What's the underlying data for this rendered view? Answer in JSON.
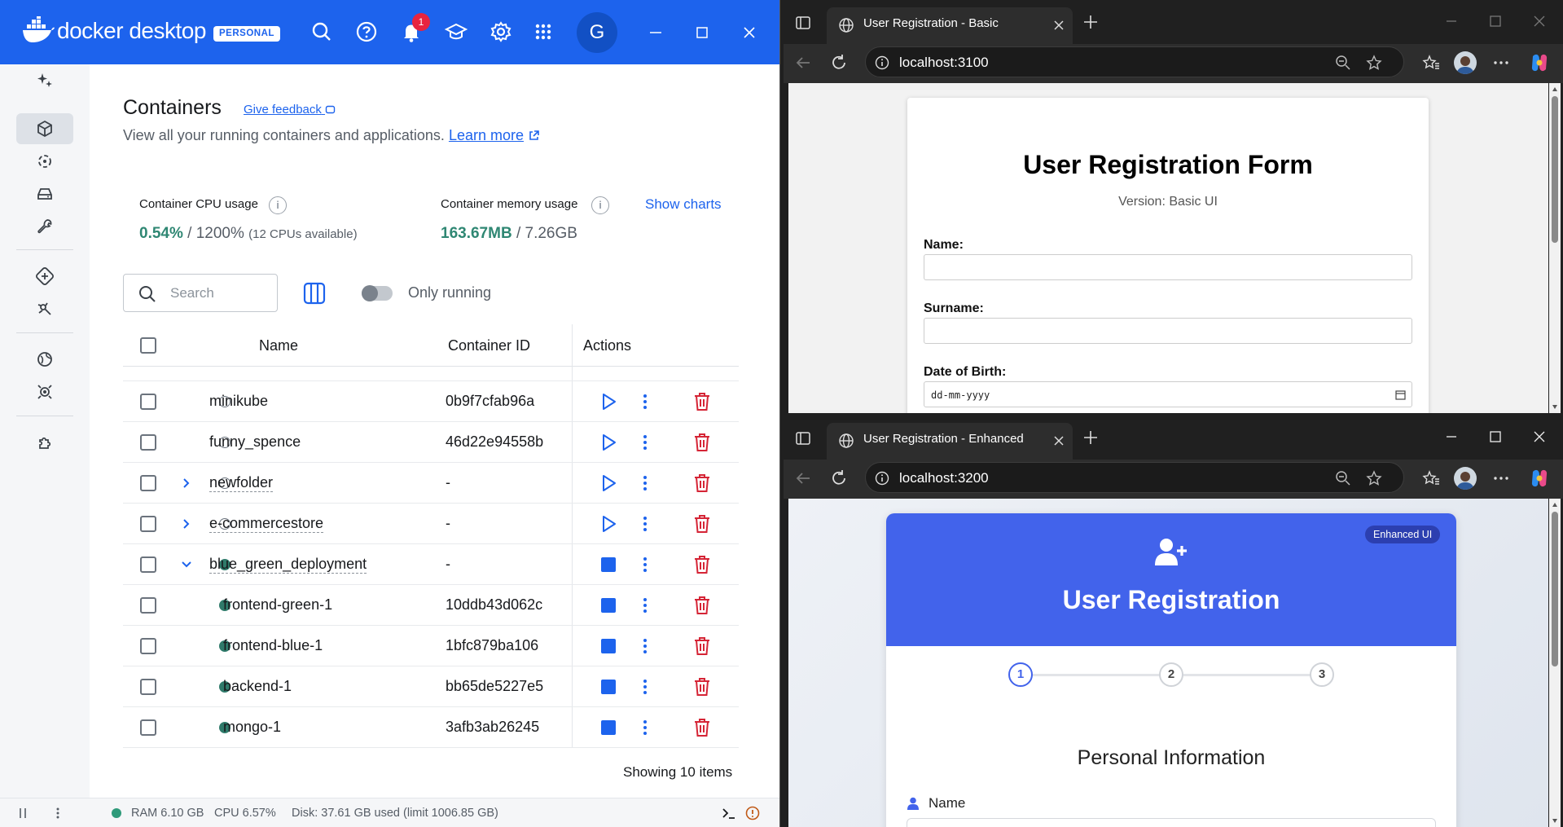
{
  "docker": {
    "brand": "docker desktop",
    "plan_badge": "PERSONAL",
    "notification_count": "1",
    "avatar_initial": "G",
    "title": "Containers",
    "feedback_link": "Give feedback",
    "subtitle": "View all your running containers and applications.",
    "learn_more": "Learn more",
    "cpu_label": "Container CPU usage",
    "cpu_value": "0.54%",
    "cpu_total": "/ 1200%",
    "cpu_note": "(12 CPUs available)",
    "mem_label": "Container memory usage",
    "mem_value": "163.67MB",
    "mem_total": "/ 7.26GB",
    "show_charts": "Show charts",
    "search_placeholder": "Search",
    "only_running": "Only running",
    "columns": {
      "name": "Name",
      "container_id": "Container ID",
      "actions": "Actions"
    },
    "rows": [
      {
        "name": "minikube",
        "id": "0b9f7cfab96a",
        "running": false,
        "group": false,
        "child": false
      },
      {
        "name": "funny_spence",
        "id": "46d22e94558b",
        "running": false,
        "group": false,
        "child": false
      },
      {
        "name": "newfolder",
        "id": "-",
        "running": false,
        "group": true,
        "expanded": false,
        "child": false
      },
      {
        "name": "e-commercestore",
        "id": "-",
        "running": false,
        "group": true,
        "expanded": false,
        "child": false
      },
      {
        "name": "blue_green_deployment",
        "id": "-",
        "running": true,
        "group": true,
        "expanded": true,
        "child": false
      },
      {
        "name": "frontend-green-1",
        "id": "10ddb43d062c",
        "running": true,
        "group": false,
        "child": true
      },
      {
        "name": "frontend-blue-1",
        "id": "1bfc879ba106",
        "running": true,
        "group": false,
        "child": true
      },
      {
        "name": "backend-1",
        "id": "bb65de5227e5",
        "running": true,
        "group": false,
        "child": true
      },
      {
        "name": "mongo-1",
        "id": "3afb3ab26245",
        "running": true,
        "group": false,
        "child": true
      }
    ],
    "showing": "Showing 10 items",
    "footer": {
      "ram": "RAM 6.10 GB",
      "cpu": "CPU 6.57%",
      "disk": "Disk: 37.61 GB used (limit 1006.85 GB)"
    },
    "colors": {
      "brand_blue": "#1d63ed",
      "running_green": "#2f7a6a",
      "delete_red": "#d52536"
    }
  },
  "browser_basic": {
    "tab_title": "User Registration - Basic",
    "url": "localhost:3100",
    "form_title": "User Registration Form",
    "version": "Version: Basic UI",
    "fields": [
      "Name:",
      "Surname:",
      "Date of Birth:"
    ],
    "date_placeholder": "dd-mm-yyyy"
  },
  "browser_enhanced": {
    "tab_title": "User Registration - Enhanced",
    "url": "localhost:3200",
    "badge": "Enhanced UI",
    "title": "User Registration",
    "steps": [
      "1",
      "2",
      "3"
    ],
    "section": "Personal Information",
    "field_name": "Name",
    "header_color": "#4263eb"
  }
}
